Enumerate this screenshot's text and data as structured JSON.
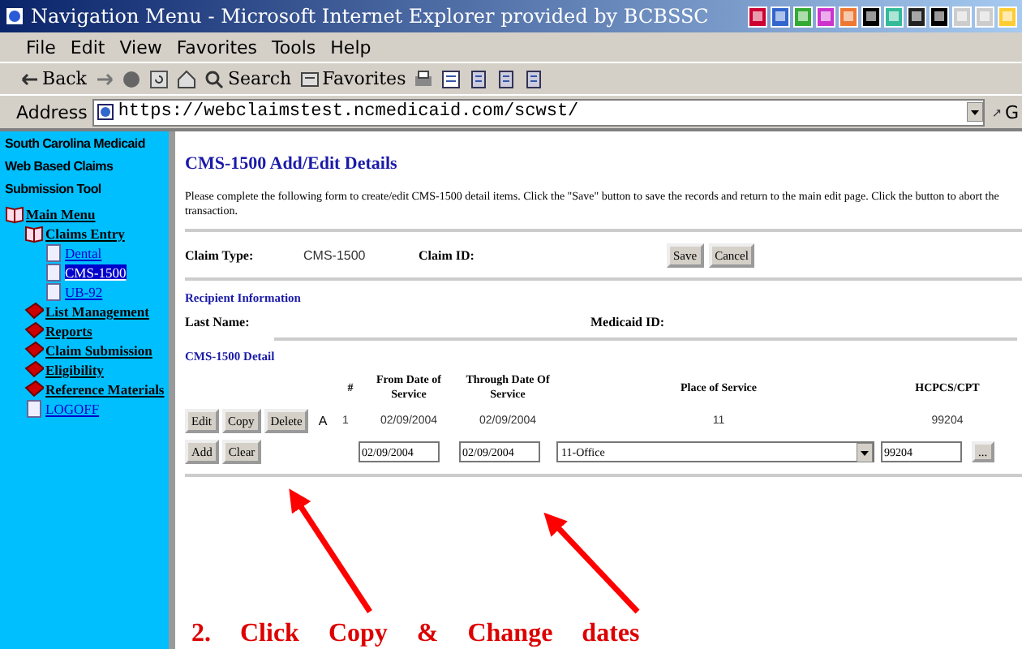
{
  "window": {
    "title": "Navigation Menu - Microsoft Internet Explorer provided by BCBSSC"
  },
  "menu": [
    "File",
    "Edit",
    "View",
    "Favorites",
    "Tools",
    "Help"
  ],
  "toolbar": [
    {
      "kind": "back",
      "label": "Back"
    },
    {
      "kind": "forward"
    },
    {
      "kind": "stop"
    },
    {
      "kind": "refresh"
    },
    {
      "kind": "home"
    },
    {
      "kind": "search",
      "label": "Search"
    },
    {
      "kind": "favorites",
      "label": "Favorites"
    },
    {
      "kind": "print"
    },
    {
      "kind": "edit"
    },
    {
      "kind": "tool"
    },
    {
      "kind": "tool"
    },
    {
      "kind": "tool"
    }
  ],
  "address": {
    "label": "Address",
    "value": "https://webclaimstest.ncmedicaid.com/scwst/",
    "go": "G"
  },
  "sidebar": {
    "heading": [
      "South Carolina Medicaid",
      "Web Based Claims",
      "Submission Tool"
    ],
    "items": [
      {
        "label": "Main Menu",
        "kind": "book-open",
        "selected": false,
        "children": [
          {
            "label": "Claims Entry",
            "kind": "book-open",
            "selected": false,
            "children": [
              {
                "label": "Dental",
                "kind": "page",
                "selected": false
              },
              {
                "label": "CMS-1500",
                "kind": "page",
                "selected": true
              },
              {
                "label": "UB-92",
                "kind": "page",
                "selected": false
              }
            ]
          },
          {
            "label": "List Management",
            "kind": "book",
            "selected": false
          },
          {
            "label": "Reports",
            "kind": "book",
            "selected": false
          },
          {
            "label": "Claim Submission",
            "kind": "book",
            "selected": false
          },
          {
            "label": "Eligibility",
            "kind": "book",
            "selected": false
          },
          {
            "label": "Reference Materials",
            "kind": "book",
            "selected": false
          },
          {
            "label": "LOGOFF",
            "kind": "page",
            "selected": false
          }
        ]
      }
    ]
  },
  "page": {
    "title": "CMS-1500 Add/Edit Details",
    "intro": "Please complete the following form to create/edit CMS-1500 detail items. Click the \"Save\" button to save the records and return to the main edit page. Click the button to abort the transaction.",
    "claim_type_label": "Claim Type:",
    "claim_type": "CMS-1500",
    "claim_id_label": "Claim ID:",
    "buttons": [
      "Save",
      "Cancel"
    ],
    "recipient_heading": "Recipient Information",
    "last_name_label": "Last Name:",
    "medicaid_id_label": "Medicaid ID:",
    "detail_heading": "CMS-1500 Detail",
    "columns": [
      "#",
      "From Date of Service",
      "Through Date Of Service",
      "Place of Service",
      "HCPCS/CPT"
    ],
    "row": {
      "buttons": [
        "Edit",
        "Copy",
        "Delete"
      ],
      "flag": "A",
      "number": "1",
      "from": "02/09/2004",
      "through": "02/09/2004",
      "place": "11",
      "code": "99204"
    },
    "entry": {
      "buttons": [
        "Add",
        "Clear"
      ],
      "from": "02/09/2004",
      "through": "02/09/2004",
      "place": "11-Office",
      "code": "99204",
      "more": "..."
    }
  },
  "annotation": "2. Click Copy & Change dates"
}
